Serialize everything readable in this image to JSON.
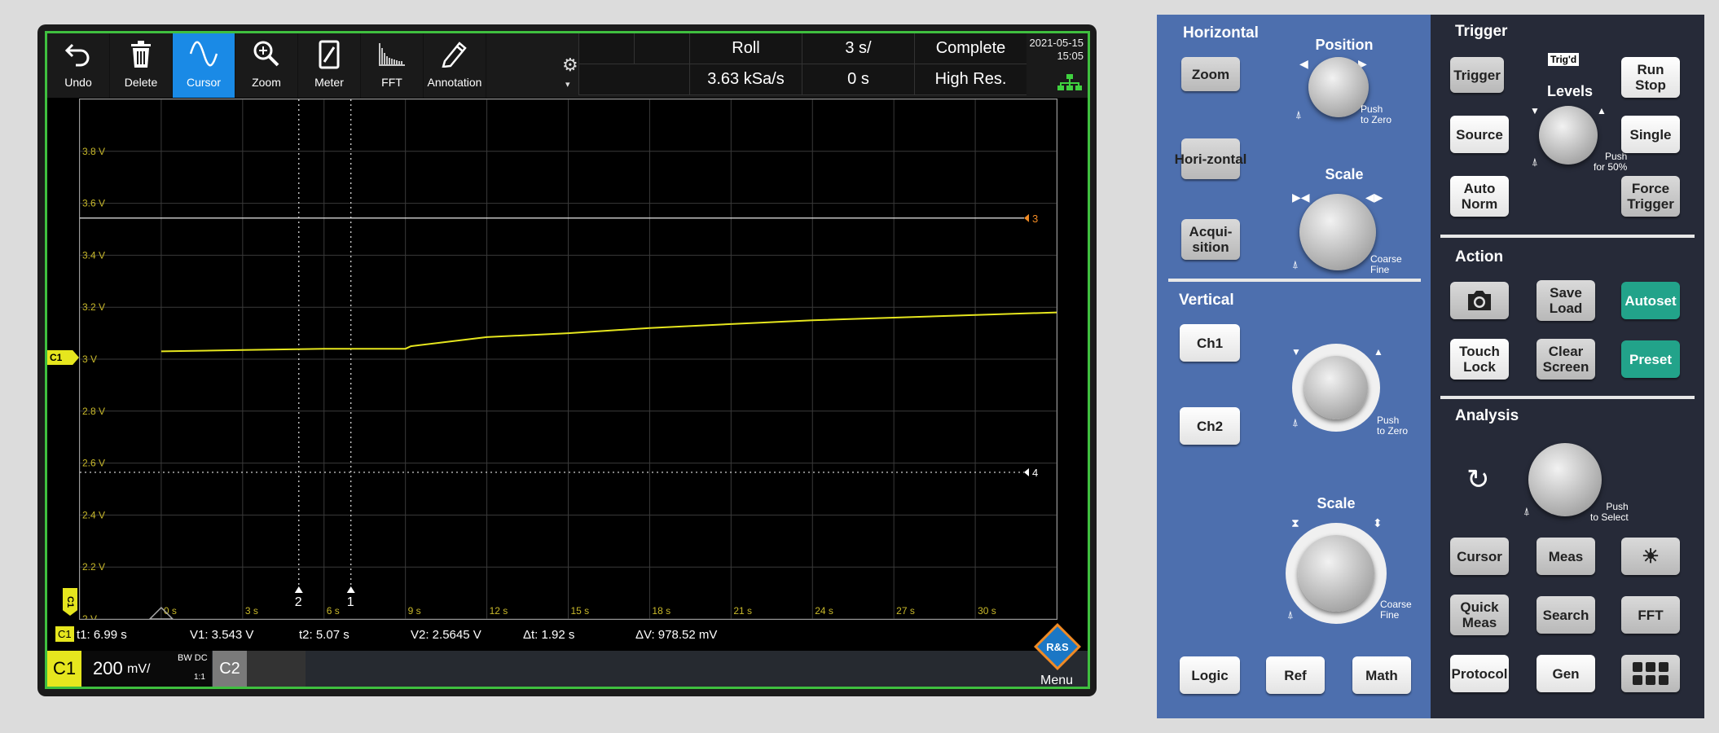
{
  "toolbar": {
    "buttons": [
      {
        "label": "Undo",
        "icon": "undo-icon"
      },
      {
        "label": "Delete",
        "icon": "trash-icon"
      },
      {
        "label": "Cursor",
        "icon": "sine-wave-icon",
        "active": true
      },
      {
        "label": "Zoom",
        "icon": "magnifier-icon"
      },
      {
        "label": "Meter",
        "icon": "meter-icon"
      },
      {
        "label": "FFT",
        "icon": "fft-icon"
      },
      {
        "label": "Annotation",
        "icon": "pen-icon"
      }
    ],
    "settings_icon": "gear-icon",
    "info": {
      "mode": "Roll",
      "timebase": "3 s/",
      "status": "Complete",
      "sample_rate": "3.63 kSa/s",
      "offset": "0 s",
      "acq_mode": "High Res."
    },
    "date": "2021-05-15",
    "time": "15:05",
    "network_icon": "network-icon"
  },
  "plot": {
    "y_labels": [
      "3.8 V",
      "3.6 V",
      "3.4 V",
      "3.2 V",
      "3 V",
      "2.8 V",
      "2.6 V",
      "2.4 V",
      "2.2 V",
      "2 V"
    ],
    "x_labels": [
      "0 s",
      "3 s",
      "6 s",
      "9 s",
      "12 s",
      "15 s",
      "18 s",
      "21 s",
      "24 s",
      "27 s",
      "30 s"
    ],
    "cursor_h_labels": [
      "3",
      "4"
    ],
    "cursor_v_labels": [
      "2",
      "1"
    ],
    "channel_marker": "C1",
    "trigger_marker": "C1"
  },
  "chart_data": {
    "type": "line",
    "series": [
      {
        "name": "C1",
        "color": "#e6e61e",
        "x": [
          0,
          3,
          6,
          9,
          9.2,
          12,
          15,
          18,
          21,
          24,
          27,
          30,
          33
        ],
        "y": [
          3.03,
          3.035,
          3.04,
          3.04,
          3.05,
          3.085,
          3.1,
          3.12,
          3.135,
          3.15,
          3.16,
          3.17,
          3.18
        ]
      }
    ],
    "xlim": [
      -3,
      33
    ],
    "ylim": [
      2.0,
      4.0
    ],
    "grid": true,
    "h_cursors": [
      {
        "label": "3",
        "value": 3.543
      },
      {
        "label": "4",
        "value": 2.5645
      }
    ],
    "v_cursors": [
      {
        "label": "2",
        "value": 5.07
      },
      {
        "label": "1",
        "value": 6.99
      }
    ]
  },
  "measurements": {
    "channel": "C1",
    "t1": "t1: 6.99 s",
    "v1": "V1: 3.543 V",
    "t2": "t2: 5.07 s",
    "v2": "V2: 2.5645 V",
    "dt": "Δt: 1.92 s",
    "dv": "ΔV: 978.52 mV"
  },
  "channel_bar": {
    "c1_label": "C1",
    "c1_scale": "200",
    "c1_unit": "mV/",
    "c1_bw": "BW DC",
    "c1_ratio": "1:1",
    "c2_label": "C2",
    "menu_label": "Menu",
    "logo_text": "R&S"
  },
  "panel": {
    "horizontal": {
      "title": "Horizontal",
      "zoom": "Zoom",
      "horizontal_btn": [
        "Hori-",
        "zontal"
      ],
      "acquisition_btn": [
        "Acqui-",
        "sition"
      ],
      "position_title": "Position",
      "position_push": [
        "Push",
        "to Zero"
      ],
      "scale_title": "Scale",
      "scale_push": [
        "Coarse",
        "Fine"
      ]
    },
    "vertical": {
      "title": "Vertical",
      "ch1": "Ch1",
      "ch2": "Ch2",
      "position_push": [
        "Push",
        "to Zero"
      ],
      "scale_title": "Scale",
      "scale_push": [
        "Coarse",
        "Fine"
      ],
      "logic": "Logic",
      "ref": "Ref",
      "math": "Math"
    },
    "trigger": {
      "title": "Trigger",
      "trigger_btn": "Trigger",
      "trigd": "Trig'd",
      "levels_title": "Levels",
      "levels_push": [
        "Push",
        "for 50%"
      ],
      "run_stop": [
        "Run",
        "Stop"
      ],
      "source": "Source",
      "single": "Single",
      "auto_norm": [
        "Auto",
        "Norm"
      ],
      "force_trigger": [
        "Force",
        "Trigger"
      ]
    },
    "action": {
      "title": "Action",
      "screenshot_icon": "camera-icon",
      "save_load": [
        "Save",
        "Load"
      ],
      "autoset": "Autoset",
      "touch_lock": [
        "Touch",
        "Lock"
      ],
      "clear_screen": [
        "Clear",
        "Screen"
      ],
      "preset": "Preset"
    },
    "analysis": {
      "title": "Analysis",
      "undo_icon": "rotate-icon",
      "push": [
        "Push",
        "to Select"
      ],
      "cursor": "Cursor",
      "meas": "Meas",
      "brightness_icon": "brightness-icon",
      "quick_meas": [
        "Quick",
        "Meas"
      ],
      "search": "Search",
      "fft": "FFT",
      "protocol": "Protocol",
      "gen": "Gen",
      "apps_icon": "apps-grid-icon"
    }
  }
}
